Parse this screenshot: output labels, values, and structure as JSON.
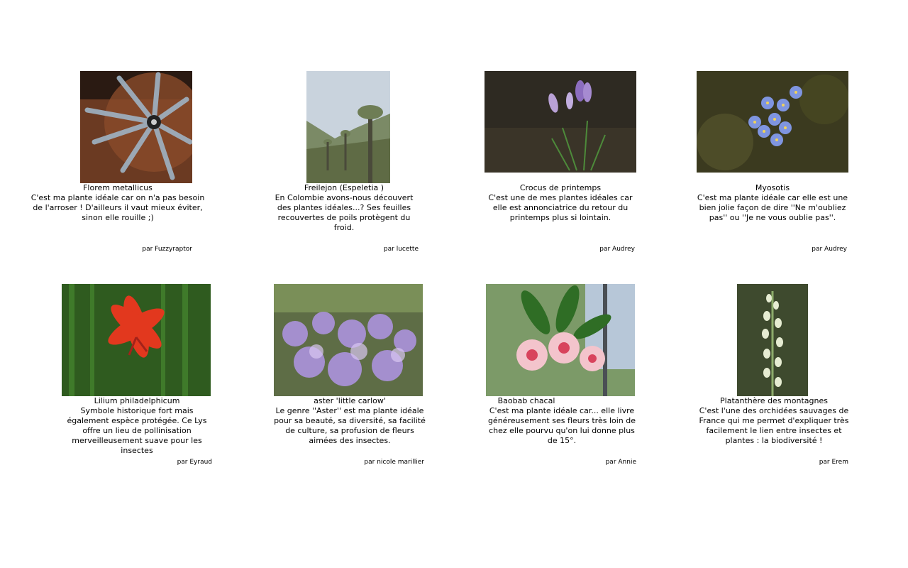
{
  "cards": [
    {
      "title": "Florem metallicus",
      "description": "C'est ma plante idéale car on n'a pas besoin de l'arroser ! D'ailleurs il vaut mieux éviter, sinon elle rouille ;)",
      "author": "par Fuzzyraptor",
      "image_icon": "metal-flower-sculpture-photo"
    },
    {
      "title": "Freilejon (Espeletia )",
      "description": "En Colombie avons-nous découvert des plantes idéales...? Ses feuilles recouvertes de poils protègent du froid.",
      "author": "par lucette",
      "image_icon": "espeletia-landscape-photo"
    },
    {
      "title": "Crocus de printemps",
      "description": "C'est une de mes plantes idéales car elle est annonciatrice du retour du printemps plus si lointain.",
      "author": "par Audrey",
      "image_icon": "crocus-photo"
    },
    {
      "title": "Myosotis",
      "description": "C'est ma plante idéale car elle est une bien jolie façon de dire ''Ne m'oubliez pas'' ou ''Je ne vous oublie pas''.",
      "author": "par Audrey",
      "image_icon": "forget-me-not-photo"
    },
    {
      "title": "Lilium philadelphicum",
      "description": "Symbole historique fort mais également espèce protégée. Ce Lys offre un lieu de pollinisation merveilleusement suave pour les insectes",
      "author": "par Eyraud",
      "image_icon": "red-lily-photo"
    },
    {
      "title": "aster 'little carlow'",
      "description": "Le genre ''Aster'' est ma plante idéale pour sa beauté, sa diversité, sa facilité de culture, sa profusion de fleurs aimées des insectes.",
      "author": "par nicole marillier",
      "image_icon": "aster-photo"
    },
    {
      "title": "Baobab chacal",
      "description": "C'est ma plante idéale car... elle livre généreusement ses fleurs très loin de chez elle pourvu qu'on lui donne plus de 15°.",
      "author": "par Annie",
      "image_icon": "desert-rose-photo"
    },
    {
      "title": "Platanthère des montagnes",
      "description": "C'est l'une des orchidées sauvages de France qui me permet d'expliquer très facilement le lien entre insectes et plantes : la biodiversité !",
      "author": "par Erem",
      "image_icon": "orchid-photo"
    }
  ]
}
